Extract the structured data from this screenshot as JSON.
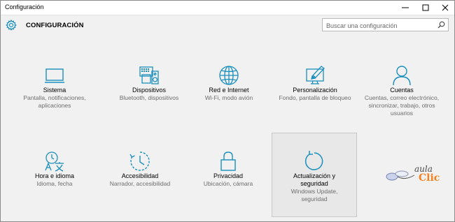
{
  "window": {
    "title": "Configuración"
  },
  "header": {
    "title": "CONFIGURACIÓN"
  },
  "search": {
    "placeholder": "Buscar una configuración"
  },
  "tiles": [
    {
      "label": "Sistema",
      "desc": "Pantalla, notificaciones, aplicaciones",
      "icon": "monitor-icon"
    },
    {
      "label": "Dispositivos",
      "desc": "Bluetooth, dispositivos",
      "icon": "keyboard-speaker-icon"
    },
    {
      "label": "Red e Internet",
      "desc": "Wi-Fi, modo avión",
      "icon": "globe-icon"
    },
    {
      "label": "Personalización",
      "desc": "Fondo, pantalla de bloqueo",
      "icon": "paintbrush-monitor-icon"
    },
    {
      "label": "Cuentas",
      "desc": "Cuentas, correo electrónico, sincronizar, trabajo, otros usuarios",
      "icon": "person-icon"
    },
    {
      "label": "Hora e idioma",
      "desc": "Idioma, fecha",
      "icon": "time-language-icon"
    },
    {
      "label": "Accesibilidad",
      "desc": "Narrador, accesibilidad",
      "icon": "accessibility-clock-icon"
    },
    {
      "label": "Privacidad",
      "desc": "Ubicación, cámara",
      "icon": "padlock-icon"
    },
    {
      "label": "Actualización y seguridad",
      "desc": "Windows Update, seguridad",
      "icon": "refresh-icon"
    }
  ],
  "logo": {
    "text_top": "aula",
    "text_bottom": "Clic"
  },
  "colors": {
    "accent": "#1a8fbd",
    "background": "#f1f1f1",
    "desc_text": "#6d6d6d",
    "logo_orange": "#f58220"
  }
}
